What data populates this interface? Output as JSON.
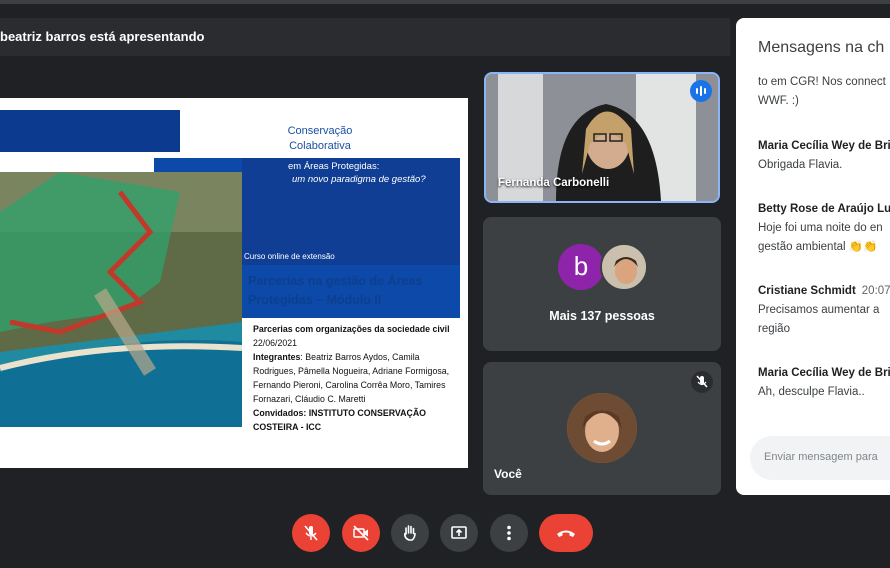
{
  "presenting": {
    "text": "beatriz barros está apresentando"
  },
  "slide": {
    "title_line1": "Conservação",
    "title_line2": "Colaborativa",
    "sub_line1": "em Áreas Protegidas:",
    "sub_line2": "um novo paradigma de gestão?",
    "course": "Curso online de extensão",
    "heading": "Parcerias na gestão de Áreas Protegidas – Módulo II",
    "topic": "Parcerias com organizações da sociedade civil",
    "date": "22/06/2021",
    "members_label": "Integrantes",
    "members": ": Beatriz Barros Aydos, Camila Rodrigues, Pâmella Nogueira, Adriane Formigosa, Fernando Pieroni, Carolina Corrêa Moro, Tamires Fornazari, Cláudio C. Maretti",
    "guests_label": "Convidados:",
    "guests": " INSTITUTO CONSERVAÇÃO COSTEIRA - ICC"
  },
  "participants": {
    "speaker_name": "Fernanda Carbonelli",
    "more_avatar_letter": "b",
    "more_label": "Mais 137 pessoas",
    "self_name": "Você"
  },
  "chat": {
    "title": "Mensagens na ch",
    "continued_text_1": "to em CGR! Nos connect",
    "continued_text_2": "WWF. :)",
    "messages": [
      {
        "sender": "Maria Cecília Wey de Bri",
        "time": "",
        "text1": "Obrigada Flavia.",
        "text2": ""
      },
      {
        "sender": "Betty Rose de Araújo Lu",
        "time": "",
        "text1": "Hoje foi uma noite do en",
        "text2": "gestão ambiental 👏👏"
      },
      {
        "sender": "Cristiane Schmidt",
        "time": "20:07",
        "text1": "Precisamos aumentar a",
        "text2": "região"
      },
      {
        "sender": "Maria Cecília Wey de Bri",
        "time": "",
        "text1": "Ah, desculpe Flavia..",
        "text2": ""
      }
    ],
    "input_placeholder": "Enviar mensagem para"
  },
  "controls": {
    "icons": [
      "mic-off-icon",
      "camera-off-icon",
      "raise-hand-icon",
      "present-screen-icon",
      "more-options-icon",
      "end-call-icon"
    ],
    "accent_red": "#ea4335",
    "speaking_blue": "#1a73e8"
  }
}
